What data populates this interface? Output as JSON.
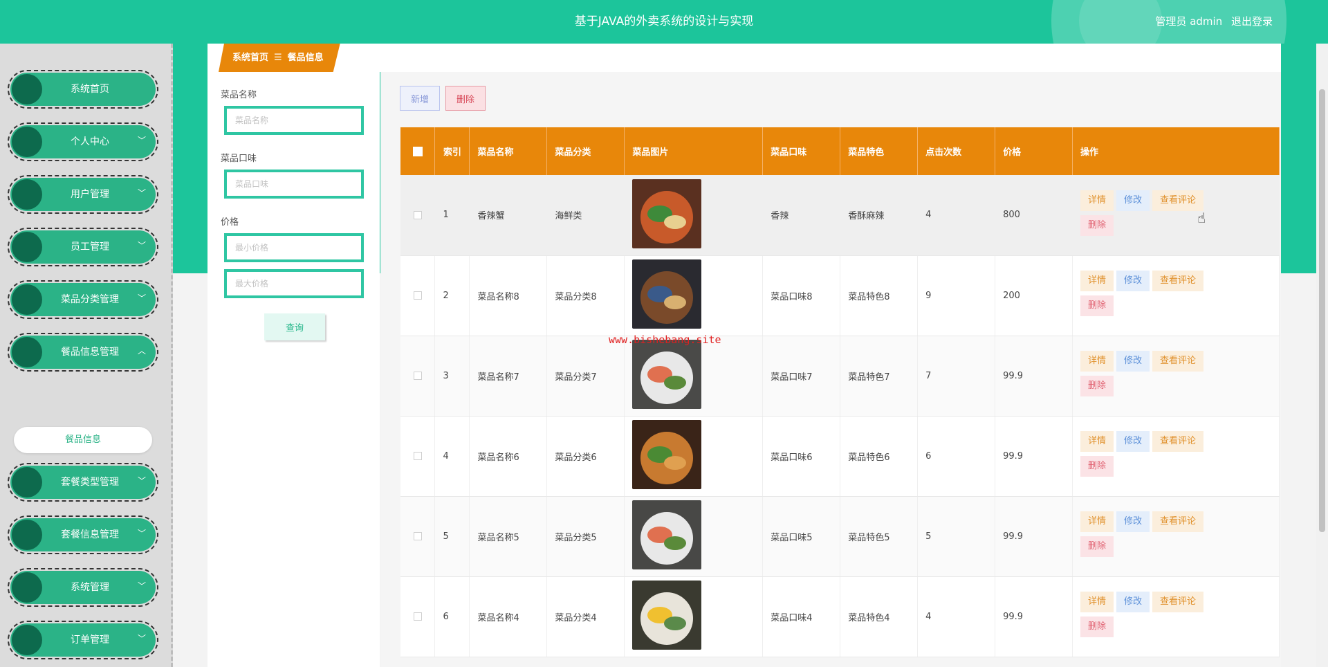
{
  "header": {
    "title": "基于JAVA的外卖系统的设计与实现",
    "user_label": "管理员 admin",
    "logout": "退出登录"
  },
  "sidebar": {
    "items": [
      {
        "label": "系统首页"
      },
      {
        "label": "个人中心"
      },
      {
        "label": "用户管理"
      },
      {
        "label": "员工管理"
      },
      {
        "label": "菜品分类管理"
      },
      {
        "label": "餐品信息管理"
      },
      {
        "label": "套餐类型管理"
      },
      {
        "label": "套餐信息管理"
      },
      {
        "label": "系统管理"
      },
      {
        "label": "订单管理"
      }
    ],
    "sub_item": "餐品信息"
  },
  "breadcrumb": {
    "home": "系统首页",
    "separator": "☰",
    "current": "餐品信息"
  },
  "search": {
    "name_label": "菜品名称",
    "name_placeholder": "菜品名称",
    "taste_label": "菜品口味",
    "taste_placeholder": "菜品口味",
    "price_label": "价格",
    "min_placeholder": "最小价格",
    "max_placeholder": "最大价格",
    "query_button": "查询"
  },
  "toolbar": {
    "add": "新增",
    "delete": "删除"
  },
  "table": {
    "headers": {
      "index": "索引",
      "name": "菜品名称",
      "category": "菜品分类",
      "image": "菜品图片",
      "taste": "菜品口味",
      "feature": "菜品特色",
      "clicks": "点击次数",
      "price": "价格",
      "actions": "操作"
    },
    "actions": {
      "detail": "详情",
      "edit": "修改",
      "review": "查看评论",
      "remove": "删除"
    },
    "rows": [
      {
        "index": "1",
        "name": "香辣蟹",
        "category": "海鲜类",
        "taste": "香辣",
        "feature": "香酥麻辣",
        "clicks": "4",
        "price": "800"
      },
      {
        "index": "2",
        "name": "菜品名称8",
        "category": "菜品分类8",
        "taste": "菜品口味8",
        "feature": "菜品特色8",
        "clicks": "9",
        "price": "200"
      },
      {
        "index": "3",
        "name": "菜品名称7",
        "category": "菜品分类7",
        "taste": "菜品口味7",
        "feature": "菜品特色7",
        "clicks": "7",
        "price": "99.9"
      },
      {
        "index": "4",
        "name": "菜品名称6",
        "category": "菜品分类6",
        "taste": "菜品口味6",
        "feature": "菜品特色6",
        "clicks": "6",
        "price": "99.9"
      },
      {
        "index": "5",
        "name": "菜品名称5",
        "category": "菜品分类5",
        "taste": "菜品口味5",
        "feature": "菜品特色5",
        "clicks": "5",
        "price": "99.9"
      },
      {
        "index": "6",
        "name": "菜品名称4",
        "category": "菜品分类4",
        "taste": "菜品口味4",
        "feature": "菜品特色4",
        "clicks": "4",
        "price": "99.9"
      }
    ]
  },
  "watermark": "www.bishebang.site",
  "colors": {
    "primary": "#1cc59b",
    "accent": "#e8870a",
    "menu": "#2bb387"
  }
}
